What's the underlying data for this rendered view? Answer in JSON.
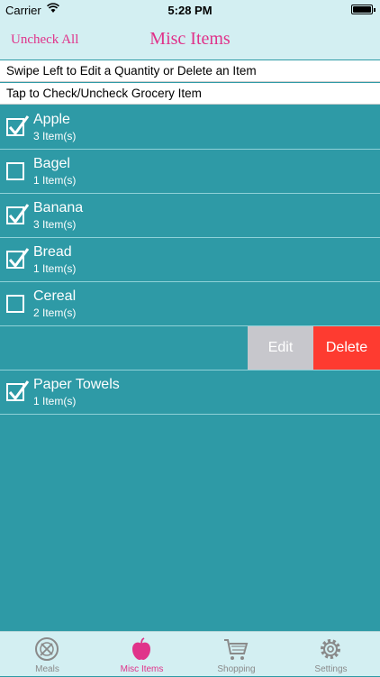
{
  "status": {
    "carrier": "Carrier",
    "time": "5:28 PM"
  },
  "nav": {
    "left_button": "Uncheck All",
    "title": "Misc Items"
  },
  "hints": [
    "Swipe Left to Edit a Quantity or Delete an Item",
    "Tap to Check/Uncheck Grocery Item"
  ],
  "items": [
    {
      "name": "Apple",
      "qty": "3 Item(s)",
      "checked": true
    },
    {
      "name": "Bagel",
      "qty": "1 Item(s)",
      "checked": false
    },
    {
      "name": "Banana",
      "qty": "3 Item(s)",
      "checked": true
    },
    {
      "name": "Bread",
      "qty": "1 Item(s)",
      "checked": true
    },
    {
      "name": "Cereal",
      "qty": "2 Item(s)",
      "checked": false
    }
  ],
  "swipe_actions": {
    "edit": "Edit",
    "delete": "Delete"
  },
  "items_after": [
    {
      "name": "Paper Towels",
      "qty": "1 Item(s)",
      "checked": true
    }
  ],
  "tabs": [
    {
      "label": "Meals",
      "icon": "meals-icon",
      "active": false
    },
    {
      "label": "Misc Items",
      "icon": "apple-icon",
      "active": true
    },
    {
      "label": "Shopping",
      "icon": "cart-icon",
      "active": false
    },
    {
      "label": "Settings",
      "icon": "gear-icon",
      "active": false
    }
  ],
  "colors": {
    "accent": "#e0338a",
    "background": "#2e9aa6",
    "delete": "#fe3b30",
    "edit": "#c7c7cc"
  }
}
